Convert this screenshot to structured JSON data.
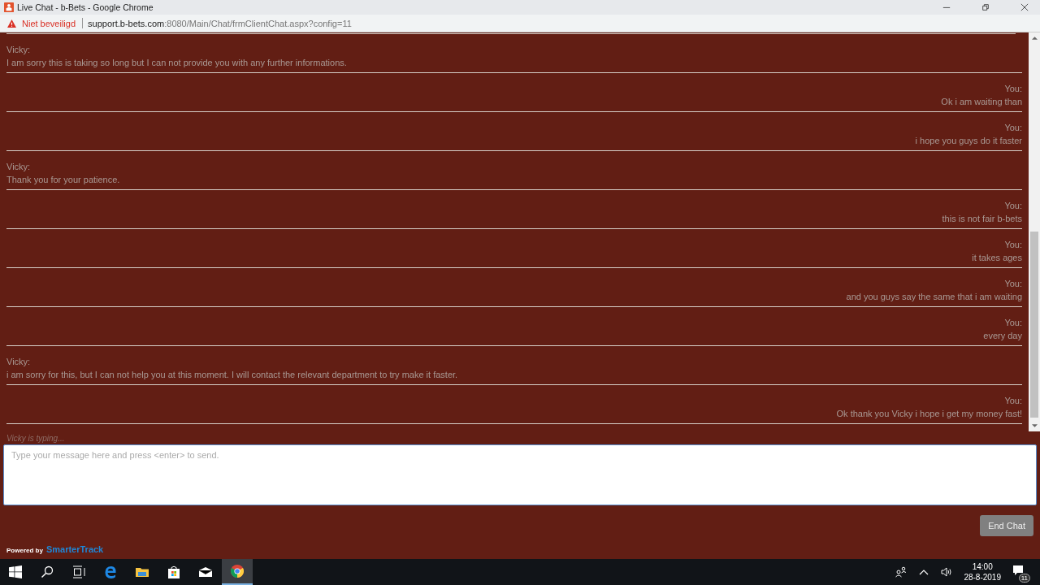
{
  "window": {
    "title": "Live Chat - b-Bets - Google Chrome"
  },
  "address_bar": {
    "security": "Niet beveiligd",
    "url_host": "support.b-bets.com",
    "url_rest": ":8080/Main/Chat/frmClientChat.aspx?config=11"
  },
  "messages": [
    {
      "kind": "agent",
      "sender": "Vicky:",
      "text": "I am sorry this is taking so long but I can not provide you with any further informations."
    },
    {
      "kind": "user",
      "sender": "You:",
      "text": "Ok i am waiting than"
    },
    {
      "kind": "user",
      "sender": "You:",
      "text": "i hope you guys do it faster"
    },
    {
      "kind": "agent",
      "sender": "Vicky:",
      "text": "Thank you for your patience."
    },
    {
      "kind": "user",
      "sender": "You:",
      "text": "this is not fair b-bets"
    },
    {
      "kind": "user",
      "sender": "You:",
      "text": "it takes ages"
    },
    {
      "kind": "user",
      "sender": "You:",
      "text": "and you guys say the same that i am waiting"
    },
    {
      "kind": "user",
      "sender": "You:",
      "text": "every day"
    },
    {
      "kind": "agent",
      "sender": "Vicky:",
      "text": "i am sorry for this, but I can not help you at this moment. I will contact the relevant department to try make it faster."
    },
    {
      "kind": "user",
      "sender": "You:",
      "text": "Ok thank you Vicky i hope i get my money fast!"
    }
  ],
  "typing_status": "Vicky is typing...",
  "composer": {
    "placeholder": "Type your message here and press <enter> to send."
  },
  "end_button": "End Chat",
  "footer": {
    "powered_by": "Powered by",
    "brand": "SmarterTrack"
  },
  "taskbar": {
    "time": "14:00",
    "date": "28-8-2019",
    "notifications": "11"
  }
}
